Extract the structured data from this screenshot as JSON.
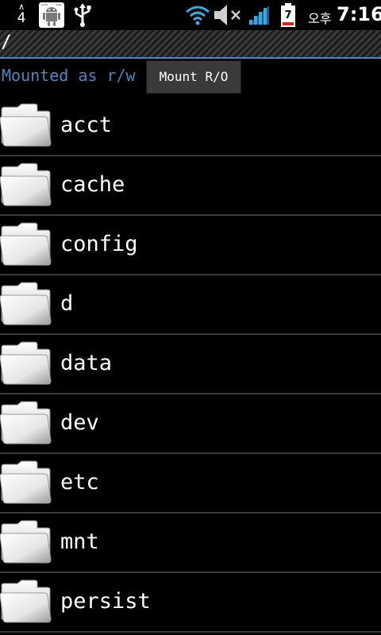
{
  "status_bar": {
    "notification_count_label": "4",
    "notification_up_glyph": "∧",
    "battery_level": "7",
    "ampm": "오후",
    "time": "7:16",
    "icons": [
      "android-debug-icon",
      "usb-icon",
      "wifi-icon",
      "mute-icon",
      "signal-icon",
      "battery-icon"
    ]
  },
  "path_bar": {
    "path": "/"
  },
  "mount": {
    "status": "Mounted as r/w",
    "button_label": "Mount R/O"
  },
  "directories": [
    {
      "name": "acct"
    },
    {
      "name": "cache"
    },
    {
      "name": "config"
    },
    {
      "name": "d"
    },
    {
      "name": "data"
    },
    {
      "name": "dev"
    },
    {
      "name": "etc"
    },
    {
      "name": "mnt"
    },
    {
      "name": "persist"
    }
  ],
  "colors": {
    "accent": "#4a87c0",
    "background": "#000000",
    "divider": "#3a3a3a",
    "button_bg": "#3a3a3a"
  }
}
